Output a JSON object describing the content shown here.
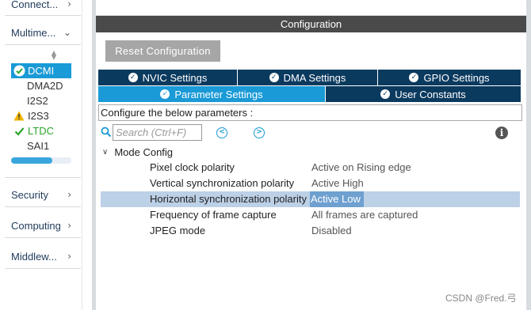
{
  "sidebar": {
    "categories": [
      {
        "label": "Connect...",
        "chevron": "›"
      },
      {
        "label": "Multime...",
        "chevron": "⌄"
      },
      {
        "label": "Security",
        "chevron": "›"
      },
      {
        "label": "Computing",
        "chevron": "›"
      },
      {
        "label": "Middlew...",
        "chevron": "›"
      }
    ],
    "items": [
      {
        "label": "DCMI",
        "state": "selected",
        "icon": "check-circle-icon"
      },
      {
        "label": "DMA2D",
        "state": "plain"
      },
      {
        "label": "I2S2",
        "state": "plain"
      },
      {
        "label": "I2S3",
        "state": "warning",
        "icon": "warning-icon"
      },
      {
        "label": "LTDC",
        "state": "ok",
        "icon": "check-icon"
      },
      {
        "label": "SAI1",
        "state": "plain"
      }
    ],
    "scroll_fraction": 0.68
  },
  "config": {
    "title": "Configuration",
    "reset_label": "Reset Configuration",
    "tabs_row1": [
      {
        "label": "NVIC Settings"
      },
      {
        "label": "DMA Settings"
      },
      {
        "label": "GPIO Settings"
      }
    ],
    "tabs_row2": [
      {
        "label": "Parameter Settings",
        "active": true
      },
      {
        "label": "User Constants",
        "active": false
      }
    ],
    "describe_label": "Configure the below parameters :",
    "search_placeholder": "Search (Ctrl+F)",
    "info_label": "i",
    "group": {
      "label": "Mode Config",
      "params": [
        {
          "name": "Pixel clock polarity",
          "value": "Active on Rising edge",
          "selected": false
        },
        {
          "name": "Vertical synchronization polarity",
          "value": "Active High",
          "selected": false
        },
        {
          "name": "Horizontal synchronization polarity",
          "value": "Active Low",
          "selected": true
        },
        {
          "name": "Frequency of frame capture",
          "value": "All frames are captured",
          "selected": false
        },
        {
          "name": "JPEG mode",
          "value": "Disabled",
          "selected": false
        }
      ]
    }
  },
  "watermark": "CSDN @Fred.弓",
  "colors": {
    "accent": "#1a9ad6",
    "tab_dark": "#0b3a5f",
    "header": "#4a4a4a",
    "ok_green": "#2aa52a",
    "warning": "#f0b400",
    "selection": "#bcd0e6"
  }
}
